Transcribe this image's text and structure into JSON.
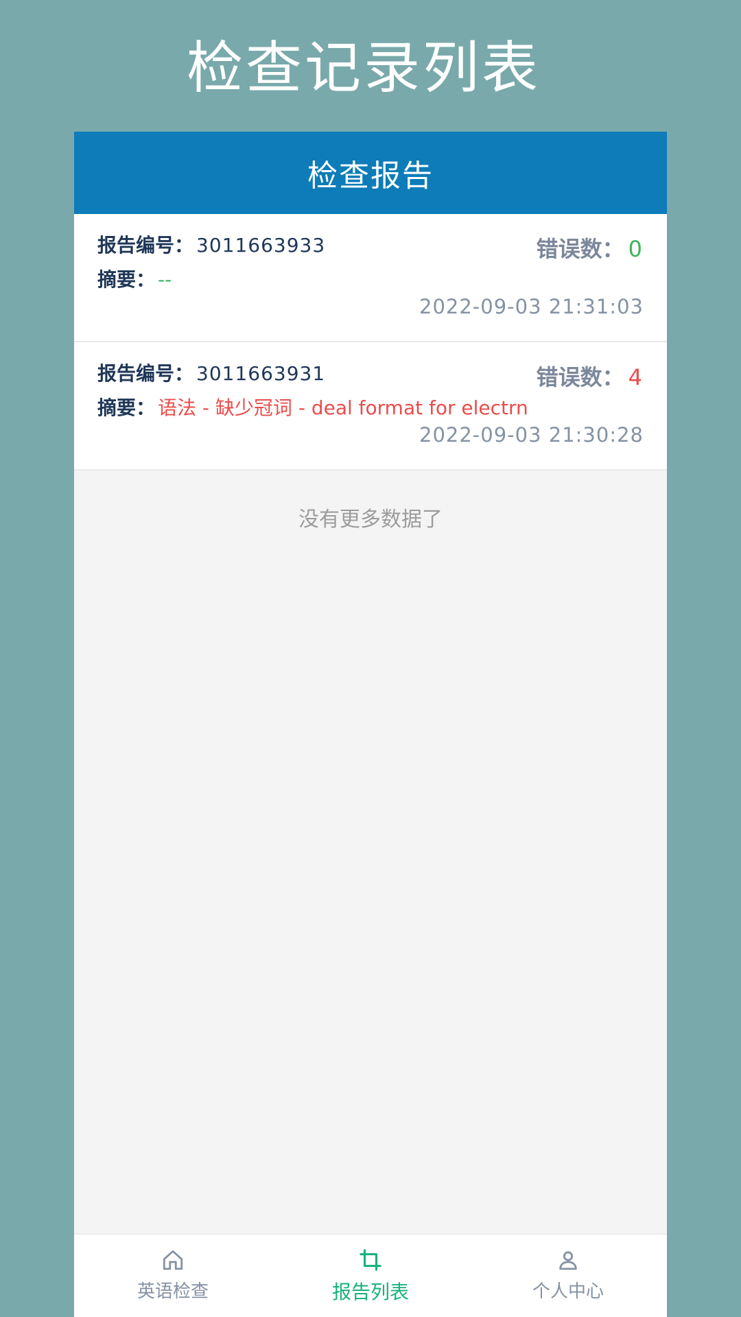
{
  "page_title": "检查记录列表",
  "nav": {
    "title": "检查报告"
  },
  "labels": {
    "report_number": "报告编号：",
    "summary": "摘要：",
    "error_count": "错误数："
  },
  "reports": [
    {
      "id": "3011663933",
      "summary": "--",
      "error_count": "0",
      "timestamp": "2022-09-03 21:31:03"
    },
    {
      "id": "3011663931",
      "summary": "语法 - 缺少冠词 - deal format for electrn",
      "error_count": "4",
      "timestamp": "2022-09-03 21:30:28"
    }
  ],
  "list_end_text": "没有更多数据了",
  "tabs": [
    {
      "label": "英语检查",
      "icon": "home-icon"
    },
    {
      "label": "报告列表",
      "icon": "crop-icon"
    },
    {
      "label": "个人中心",
      "icon": "user-icon"
    }
  ],
  "colors": {
    "background": "#79a9ab",
    "nav_bar": "#0d7cb8",
    "active_tab": "#18b27a",
    "error": "#ec4b4b",
    "ok": "#3bb55c"
  }
}
